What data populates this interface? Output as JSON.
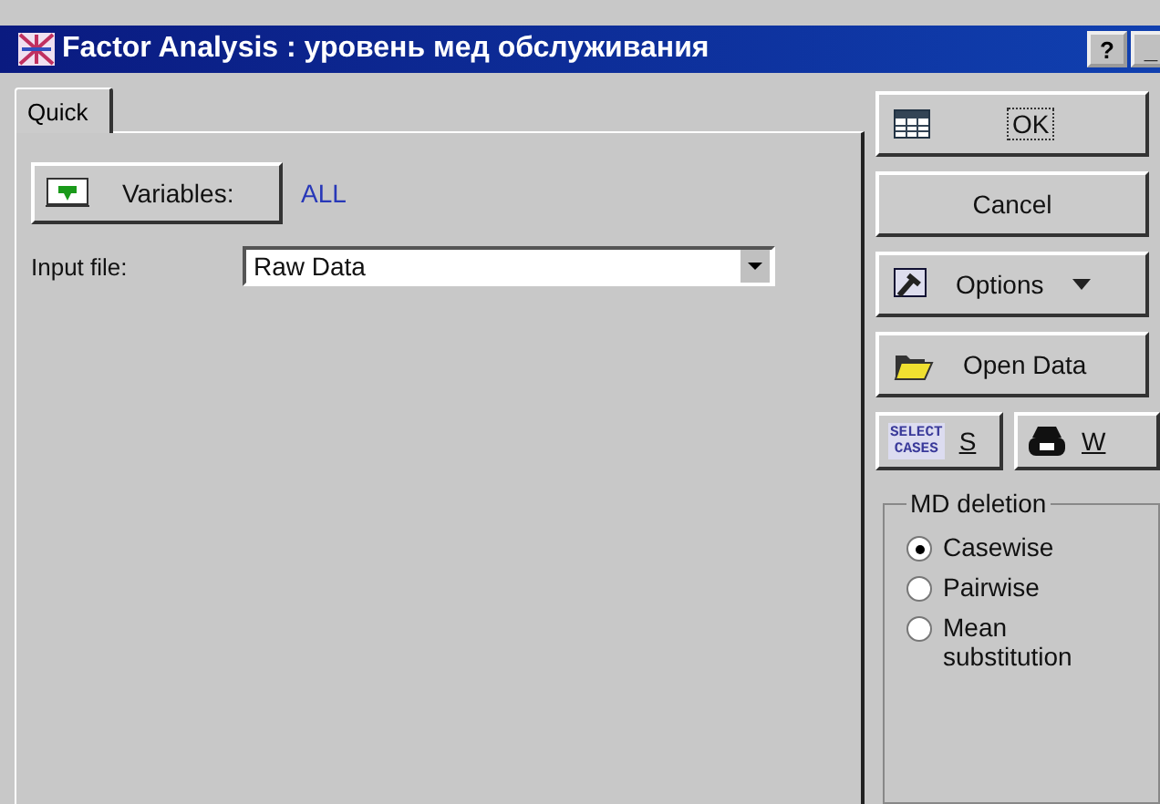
{
  "window": {
    "title": "Factor Analysis : уровень мед обслуживания",
    "buttons": [
      "?",
      "_"
    ]
  },
  "tabs": [
    {
      "label": "Quick",
      "selected": true
    }
  ],
  "variables": {
    "button": "Variables:",
    "value": "ALL"
  },
  "input_file": {
    "label": "Input file:",
    "value": "Raw Data"
  },
  "side_buttons": [
    {
      "kind": "ok",
      "label": "OK"
    },
    {
      "kind": "plain",
      "label": "Cancel"
    },
    {
      "kind": "options",
      "label": "Options"
    },
    {
      "kind": "open",
      "label": "Open Data"
    }
  ],
  "select_cases": {
    "icon_lines": [
      "SELECT",
      "CASES"
    ],
    "label": "S"
  },
  "weights": {
    "label": "W"
  },
  "md_deletion": {
    "title": "MD deletion",
    "options": [
      {
        "label": "Casewise",
        "selected": true
      },
      {
        "label": "Pairwise",
        "selected": false
      },
      {
        "label": "Mean substitution",
        "selected": false
      }
    ]
  }
}
